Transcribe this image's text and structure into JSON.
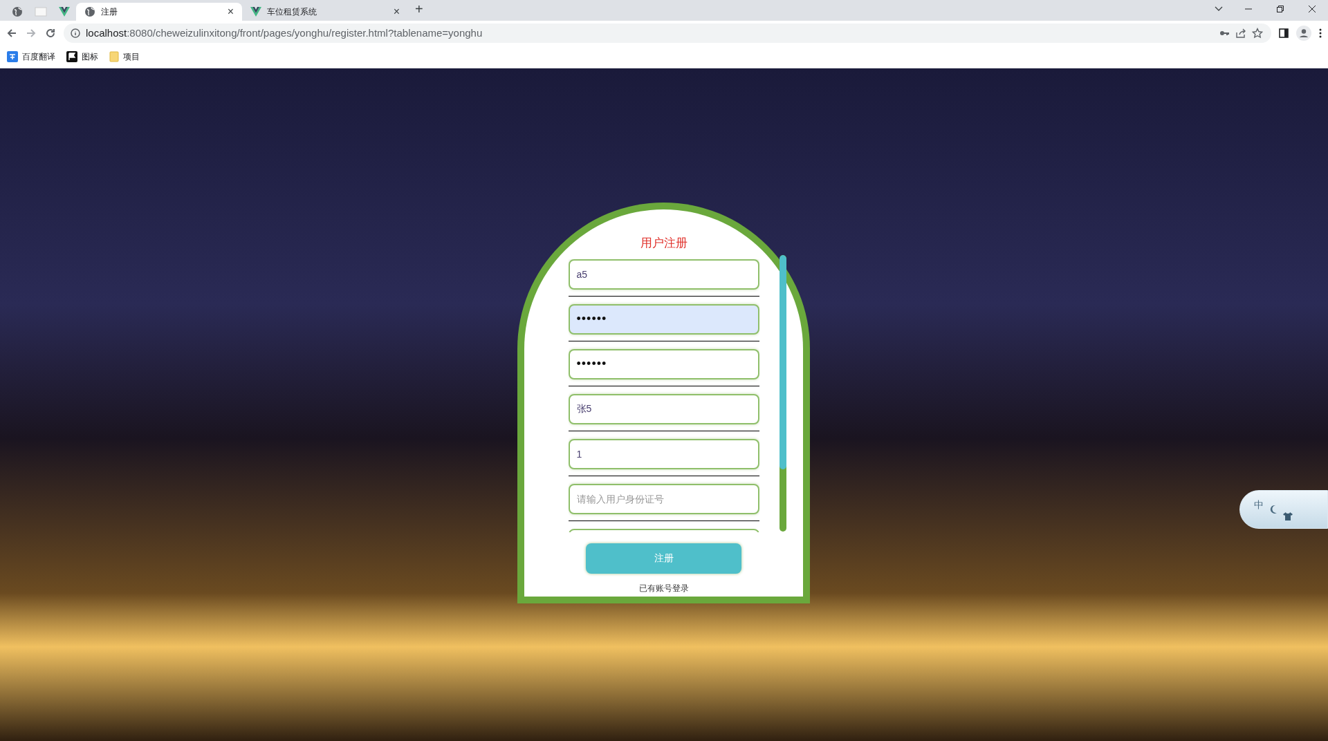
{
  "browser": {
    "tabs": [
      {
        "kind": "pinned",
        "selected": false
      },
      {
        "kind": "pinned",
        "selected": false
      },
      {
        "kind": "pinned",
        "selected": false
      },
      {
        "kind": "full",
        "title": "注册",
        "close": "×",
        "selected": true
      },
      {
        "kind": "full",
        "title": "车位租赁系统",
        "close": "×",
        "selected": false
      }
    ],
    "new_tab": "+",
    "address": {
      "host": "localhost",
      "rest": ":8080/cheweizulinxitong/front/pages/yonghu/register.html?tablename=yonghu"
    },
    "bookmarks": [
      {
        "label": "百度翻译"
      },
      {
        "label": "图标"
      },
      {
        "label": "项目"
      }
    ]
  },
  "form": {
    "title": "用户注册",
    "fields": [
      {
        "kind": "text",
        "value": "a5",
        "autofilled": false
      },
      {
        "kind": "password",
        "value": "••••••",
        "autofilled": true
      },
      {
        "kind": "password",
        "value": "••••••",
        "autofilled": false
      },
      {
        "kind": "text",
        "value": "张5",
        "autofilled": false
      },
      {
        "kind": "text",
        "value": "1",
        "autofilled": false
      },
      {
        "kind": "text",
        "placeholder": "请输入用户身份证号",
        "autofilled": false
      }
    ],
    "submit": "注册",
    "login_link": "已有账号登录"
  },
  "ime_toolbar": {
    "mode": "中"
  }
}
